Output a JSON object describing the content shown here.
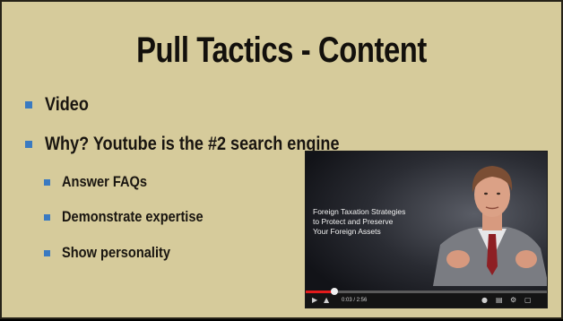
{
  "slide": {
    "title": "Pull Tactics - Content",
    "bullets": [
      {
        "text": "Video"
      },
      {
        "text": "Why? Youtube is the #2 search engine"
      }
    ],
    "sub_bullets": [
      {
        "text": "Answer FAQs"
      },
      {
        "text": "Demonstrate expertise"
      },
      {
        "text": "Show personality"
      }
    ],
    "colors": {
      "background": "#d6cb9b",
      "bullet": "#3a7ac1",
      "text": "#191510"
    }
  },
  "video": {
    "caption": "Foreign Taxation Strategies\nto Protect and Preserve\nYour Foreign Assets",
    "time": "0:03 / 2:56",
    "progress": 0.12,
    "icons": [
      "play-icon",
      "volume-icon",
      "hd-icon",
      "captions-icon",
      "settings-icon",
      "fullscreen-icon"
    ]
  }
}
